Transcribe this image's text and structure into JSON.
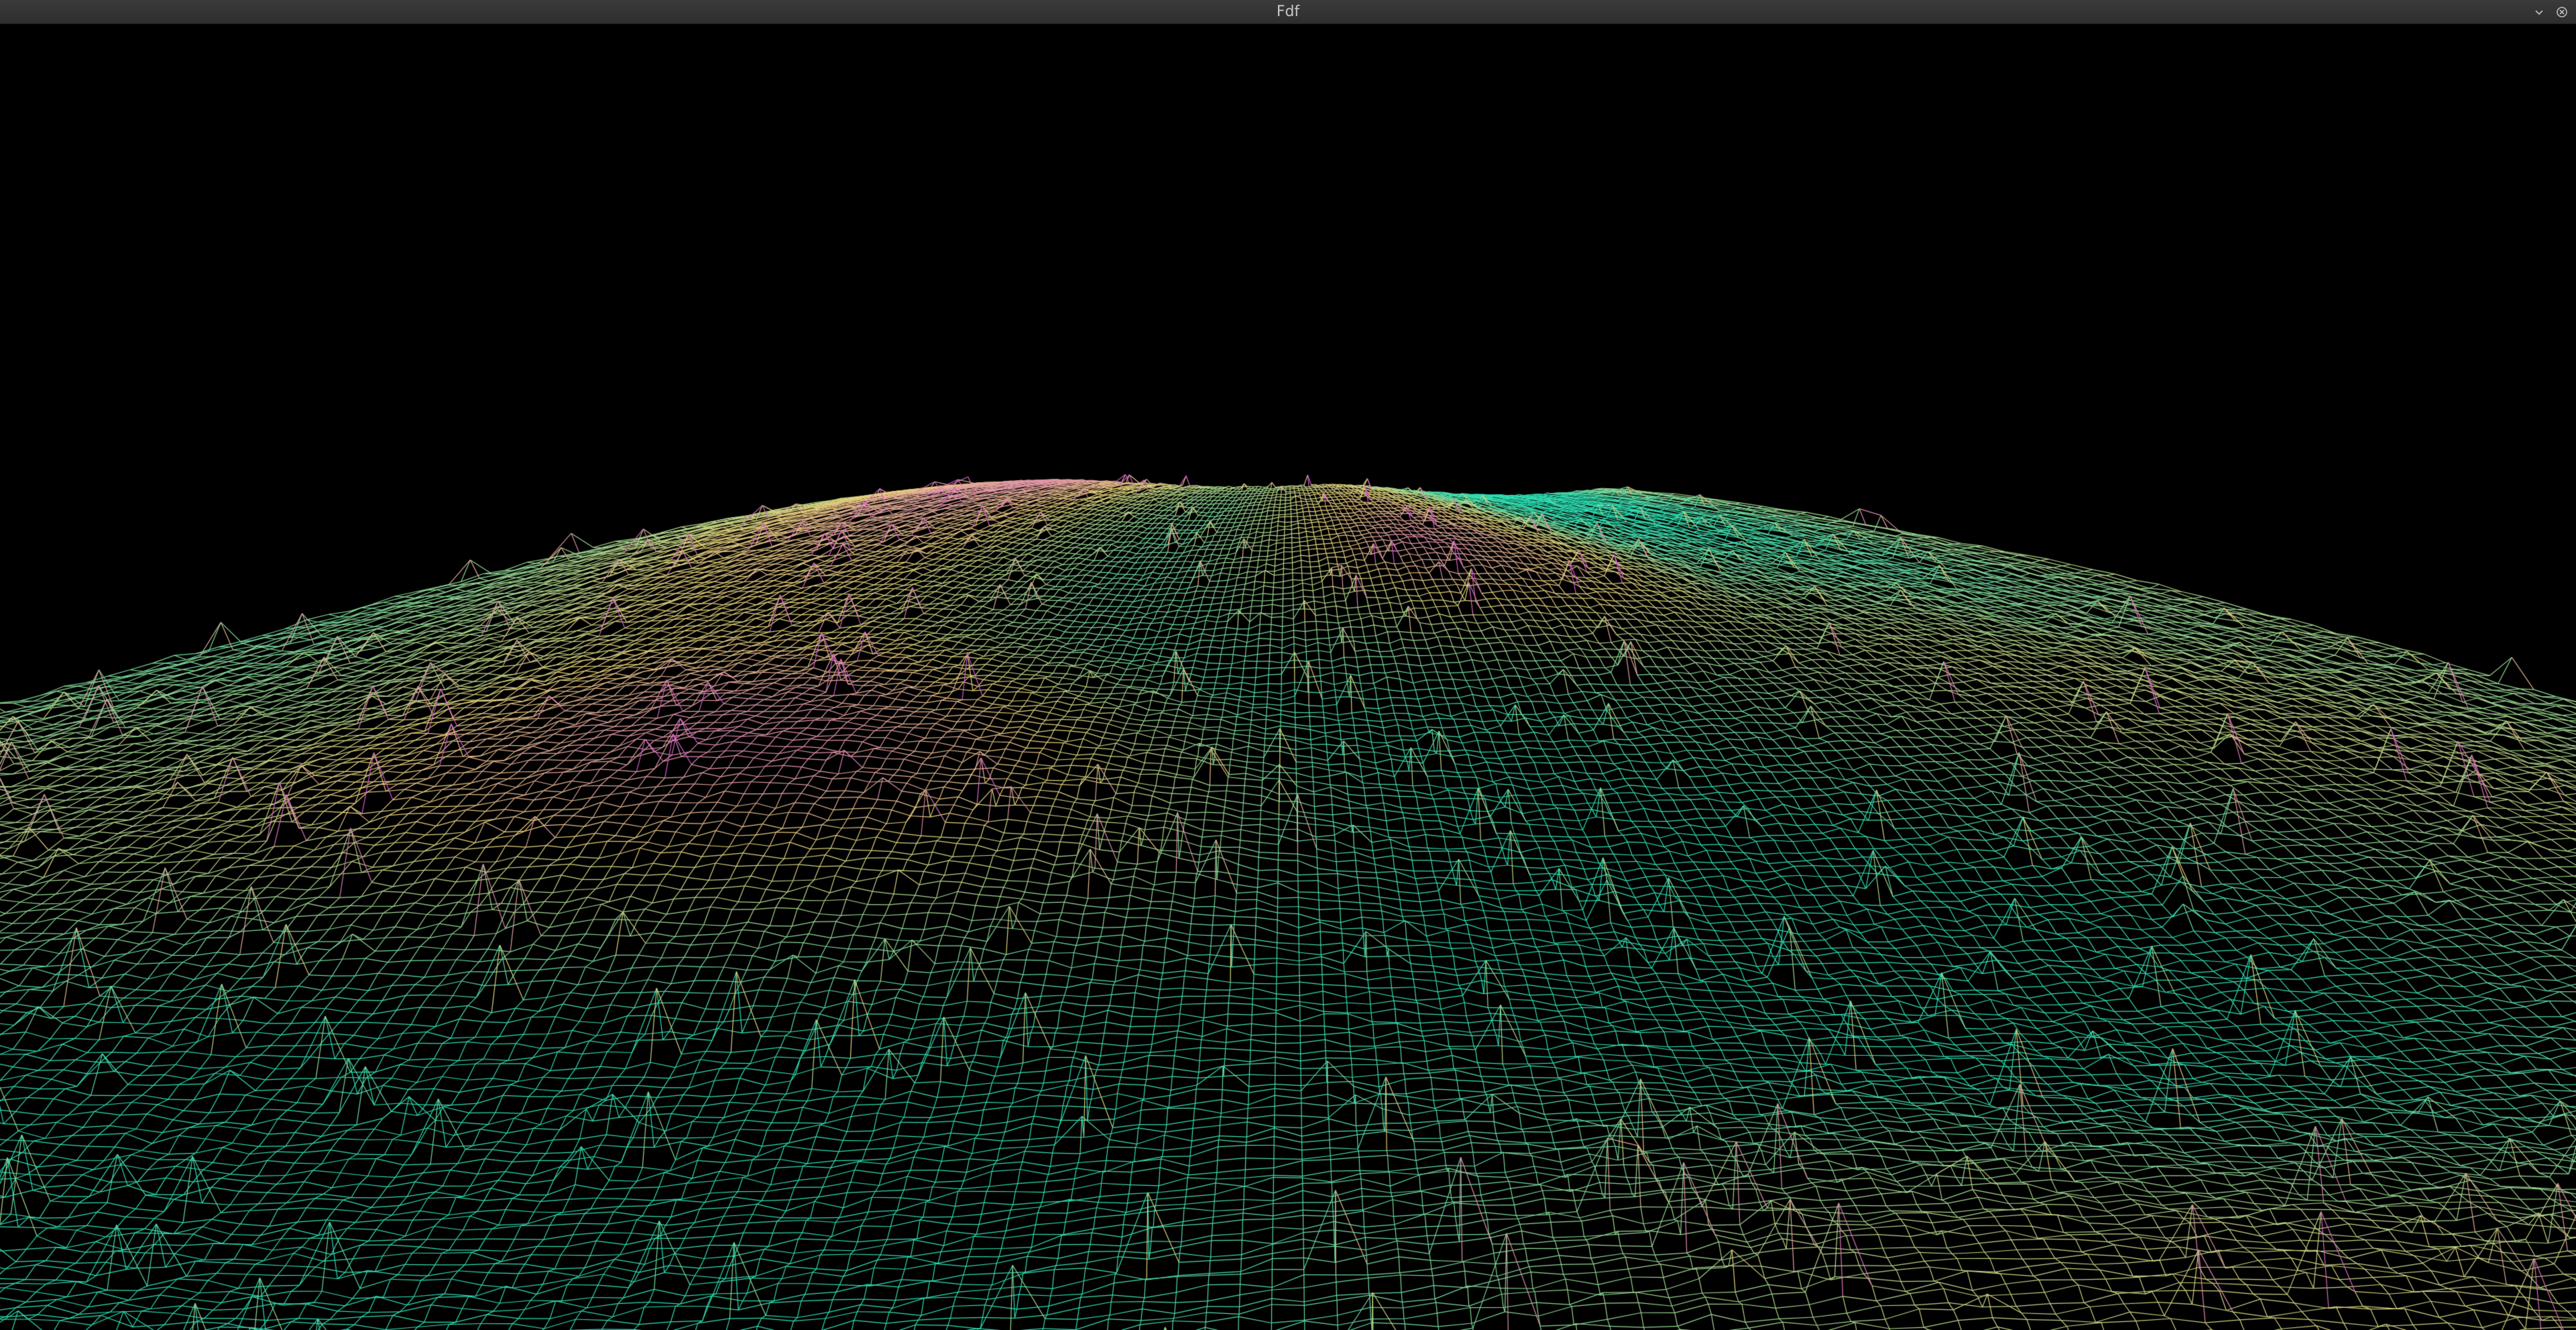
{
  "window": {
    "title": "Fdf",
    "controls": [
      {
        "name": "minimize",
        "icon": "chevron-down-icon"
      },
      {
        "name": "close",
        "icon": "close-icon"
      }
    ]
  },
  "render": {
    "background": "#000000",
    "palette": {
      "low": "#2fe0b4",
      "mid": "#e8d27a",
      "high": "#d95fd0"
    }
  }
}
